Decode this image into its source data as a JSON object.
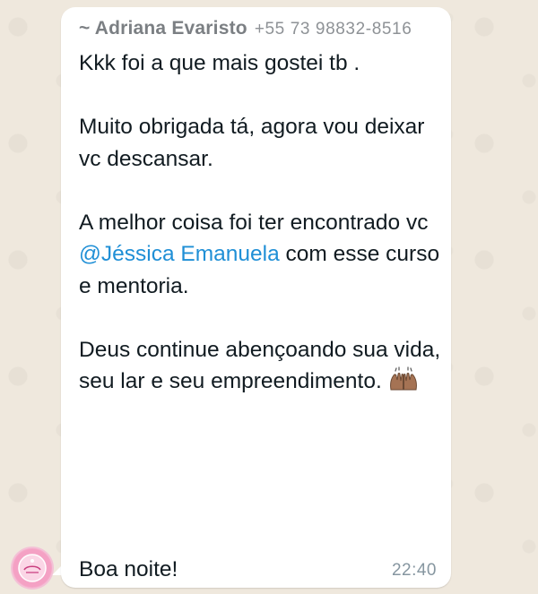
{
  "colors": {
    "chat_background": "#efe8dd",
    "bubble": "#ffffff",
    "sender_name": "#7b7f83",
    "mention": "#1f8fd6",
    "timestamp": "#8696a0"
  },
  "message": {
    "sender_name": "~ Adriana Evaristo",
    "sender_phone": "+55 73 98832-8516",
    "line1": "Kkk foi a que mais gostei tb .",
    "line2": "Muito obrigada tá, agora vou deixar vc descansar.",
    "line3_before_mention": "A melhor coisa foi ter encontrado vc ",
    "mention": "@Jéssica Emanuela",
    "line3_after_mention": " com esse curso e mentoria.",
    "line4": "Deus continue abençoando sua vida, seu lar e seu empreendimento.",
    "emoji_icon": "raising-hands-emoji",
    "closing": "Boa noite!",
    "timestamp": "22:40"
  },
  "avatar": {
    "icon": "group-avatar-logo"
  }
}
